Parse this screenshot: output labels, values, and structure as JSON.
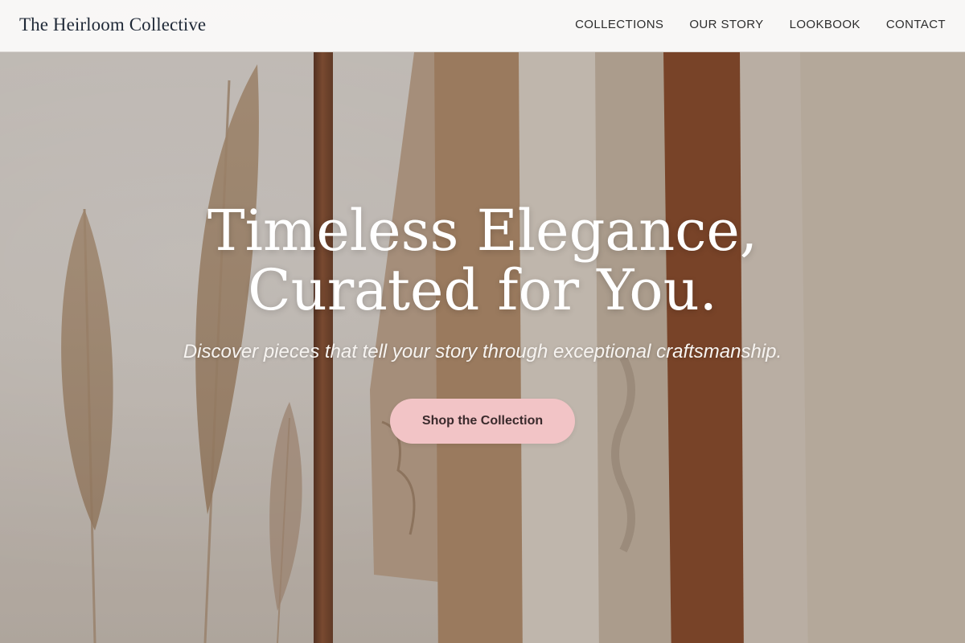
{
  "header": {
    "brand": "The Heirloom Collective",
    "nav": [
      {
        "label": "COLLECTIONS"
      },
      {
        "label": "OUR STORY"
      },
      {
        "label": "LOOKBOOK"
      },
      {
        "label": "CONTACT"
      }
    ]
  },
  "hero": {
    "title_line1": "Timeless Elegance,",
    "title_line2": "Curated for You.",
    "subtitle": "Discover pieces that tell your story through exceptional craftsmanship.",
    "cta_label": "Shop the Collection",
    "image": "clothing rack with knit sweaters and pampas grass"
  },
  "colors": {
    "header_bg": "#fcfbfa",
    "brand_text": "#1f2937",
    "cta_bg": "#f2c4c6",
    "cta_text": "#3a2a2c",
    "hero_text": "#ffffff"
  }
}
